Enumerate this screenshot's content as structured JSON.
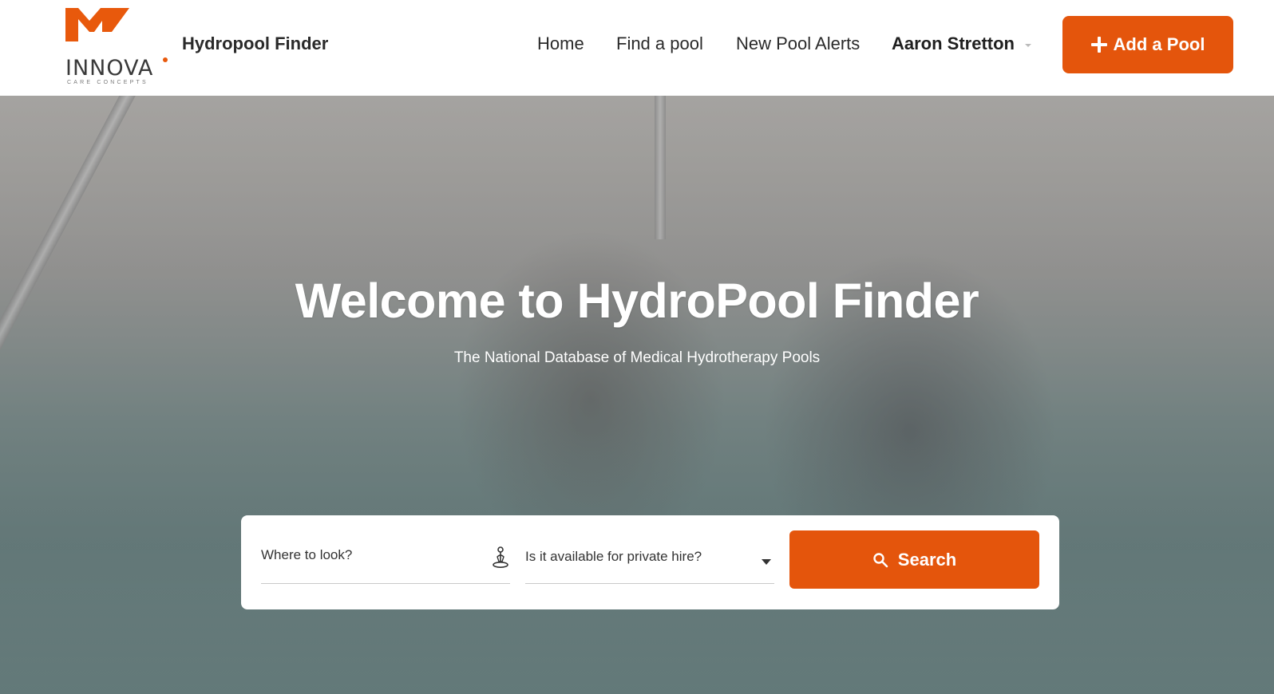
{
  "header": {
    "logo": {
      "wordmark": "INNOVA",
      "tagline": "CARE CONCEPTS",
      "mark_color": "#e8590c"
    },
    "site_title": "Hydropool Finder",
    "nav": {
      "home": "Home",
      "find": "Find a pool",
      "alerts": "New Pool Alerts",
      "user": "Aaron Stretton"
    },
    "add_button": {
      "label": "Add a Pool",
      "icon": "plus-icon"
    }
  },
  "hero": {
    "title": "Welcome to HydroPool Finder",
    "subtitle": "The National Database of Medical Hydrotherapy Pools"
  },
  "search": {
    "location": {
      "placeholder": "Where to look?",
      "icon": "location-pin-icon"
    },
    "private_hire": {
      "selected": "Is it available for private hire?",
      "icon": "caret-down-icon"
    },
    "button": {
      "label": "Search",
      "icon": "search-icon"
    }
  },
  "colors": {
    "accent": "#e4550c",
    "text": "#2a2a2a"
  }
}
